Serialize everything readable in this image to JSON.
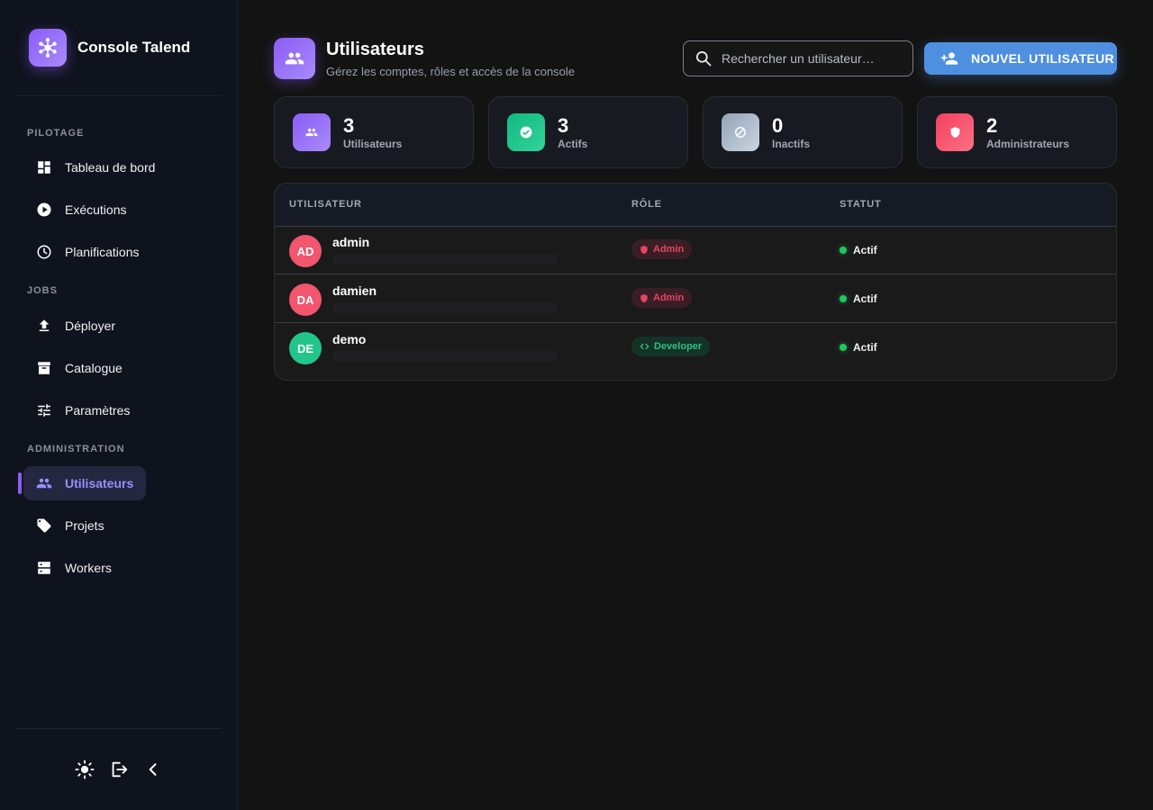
{
  "app": {
    "title": "Console Talend"
  },
  "sidebar": {
    "sections": [
      {
        "label": "PILOTAGE",
        "items": [
          {
            "label": "Tableau de bord",
            "icon": "dashboard-icon"
          },
          {
            "label": "Exécutions",
            "icon": "play-circle-icon"
          },
          {
            "label": "Planifications",
            "icon": "clock-icon"
          }
        ]
      },
      {
        "label": "JOBS",
        "items": [
          {
            "label": "Déployer",
            "icon": "upload-icon"
          },
          {
            "label": "Catalogue",
            "icon": "archive-icon"
          },
          {
            "label": "Paramètres",
            "icon": "sliders-icon"
          }
        ]
      },
      {
        "label": "ADMINISTRATION",
        "items": [
          {
            "label": "Utilisateurs",
            "icon": "users-icon",
            "active": true
          },
          {
            "label": "Projets",
            "icon": "tag-icon"
          },
          {
            "label": "Workers",
            "icon": "server-icon"
          }
        ]
      }
    ],
    "footer": [
      "sun-icon",
      "logout-icon",
      "chevron-left-icon"
    ]
  },
  "header": {
    "title": "Utilisateurs",
    "subtitle": "Gérez les comptes, rôles et accès de la console",
    "search_placeholder": "Rechercher un utilisateur…",
    "new_user_label": "NOUVEL UTILISATEUR"
  },
  "stats": [
    {
      "value": "3",
      "label": "Utilisateurs",
      "icon": "users-icon",
      "color": "#8b5cf6"
    },
    {
      "value": "3",
      "label": "Actifs",
      "icon": "check-circle-icon",
      "color": "#10b981"
    },
    {
      "value": "0",
      "label": "Inactifs",
      "icon": "block-icon",
      "color": "#94a3b8"
    },
    {
      "value": "2",
      "label": "Administrateurs",
      "icon": "shield-icon",
      "color": "#f43f5e"
    }
  ],
  "table": {
    "columns": [
      "UTILISATEUR",
      "RÔLE",
      "STATUT"
    ],
    "rows": [
      {
        "initials": "AD",
        "username": "admin",
        "role": "Admin",
        "status": "Actif",
        "avatar_color": "#f2566e"
      },
      {
        "initials": "DA",
        "username": "damien",
        "role": "Admin",
        "status": "Actif",
        "avatar_color": "#f2566e"
      },
      {
        "initials": "DE",
        "username": "demo",
        "role": "Developer",
        "status": "Actif",
        "avatar_color": "#22c58b"
      }
    ]
  },
  "colors": {
    "accent": "#8b5cf6",
    "primary_button": "#4f8fe0",
    "status_active": "#22c55e"
  }
}
